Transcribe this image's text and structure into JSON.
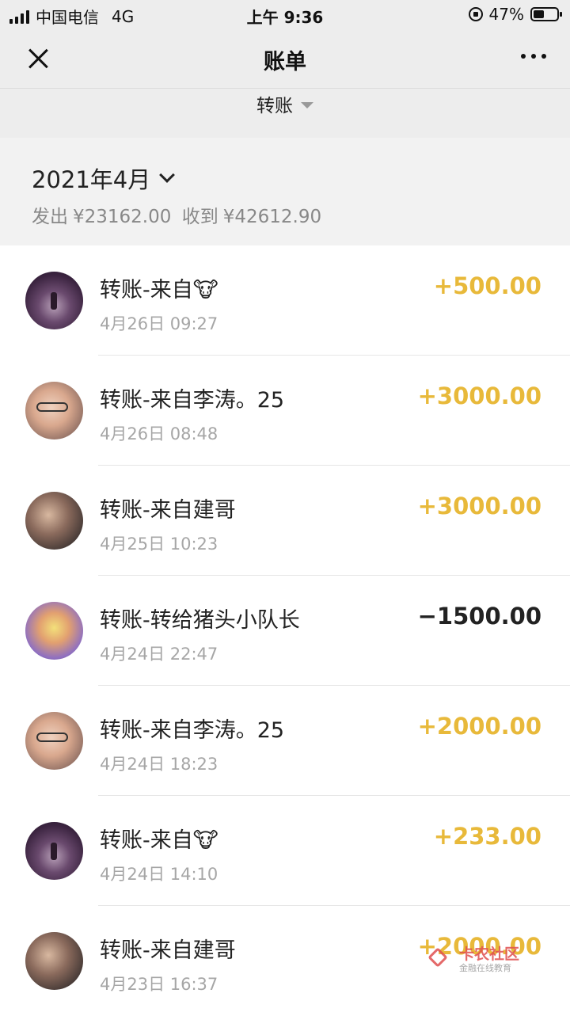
{
  "status_bar": {
    "carrier": "中国电信",
    "network": "4G",
    "time": "上午 9:36",
    "battery_percent": "47%",
    "battery_level": 0.47
  },
  "nav": {
    "title": "账单"
  },
  "filter": {
    "label": "转账"
  },
  "month": {
    "title": "2021年4月",
    "sent_label": "发出",
    "sent": "¥23162.00",
    "received_label": "收到",
    "received": "¥42612.90"
  },
  "transactions": [
    {
      "title": "转账-来自🐮",
      "time": "4月26日 09:27",
      "amount": "+500.00",
      "direction": "in",
      "avatar": "city-night-photo"
    },
    {
      "title": "转账-来自李涛。25",
      "time": "4月26日 08:48",
      "amount": "+3000.00",
      "direction": "in",
      "avatar": "baby-with-glasses-photo"
    },
    {
      "title": "转账-来自建哥",
      "time": "4月25日 10:23",
      "amount": "+3000.00",
      "direction": "in",
      "avatar": "man-in-car-photo"
    },
    {
      "title": "转账-转给猪头小队长",
      "time": "4月24日 22:47",
      "amount": "−1500.00",
      "direction": "out",
      "avatar": "cartoon-girl-photo"
    },
    {
      "title": "转账-来自李涛。25",
      "time": "4月24日 18:23",
      "amount": "+2000.00",
      "direction": "in",
      "avatar": "baby-with-glasses-photo"
    },
    {
      "title": "转账-来自🐮",
      "time": "4月24日 14:10",
      "amount": "+233.00",
      "direction": "in",
      "avatar": "city-night-photo"
    },
    {
      "title": "转账-来自建哥",
      "time": "4月23日 16:37",
      "amount": "+2000.00",
      "direction": "in",
      "avatar": "man-in-car-photo"
    }
  ],
  "watermark": {
    "title": "卡农社区",
    "subtitle": "金融在线教育"
  },
  "colors": {
    "income": "#e8b93a",
    "expense": "#222222",
    "header_bg": "#ededed"
  }
}
